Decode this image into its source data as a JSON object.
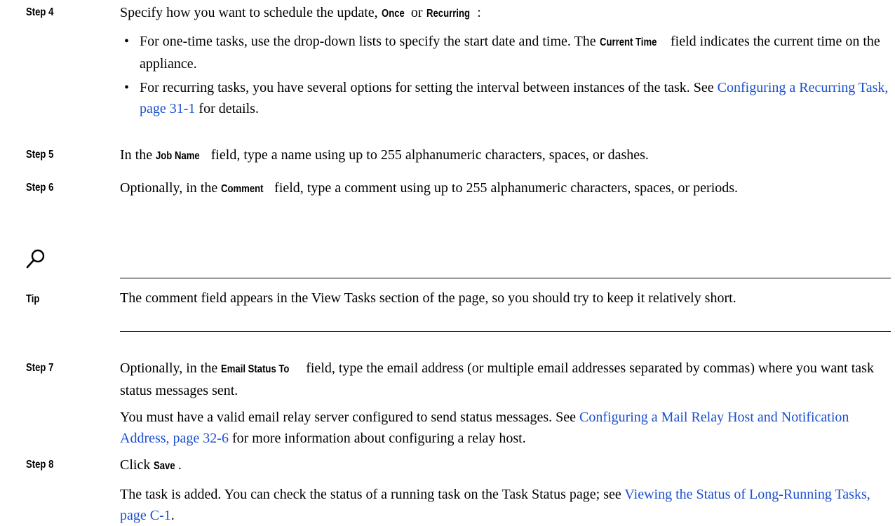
{
  "steps": {
    "s4": {
      "label": "Step 4",
      "pre": "Specify how you want to schedule the update, ",
      "once": "Once",
      "or": " or ",
      "recurring": "Recurring",
      "post": ":",
      "bullet1_pre": "For one-time tasks, use the drop-down lists to specify the start date and time. The ",
      "bullet1_bold": "Current Time",
      "bullet1_post": " field indicates the current time on the appliance.",
      "bullet2_pre": "For recurring tasks, you have several options for setting the interval between instances of the task. See ",
      "bullet2_link": "Configuring a Recurring Task, page 31-1",
      "bullet2_post": " for details."
    },
    "s5": {
      "label": "Step 5",
      "pre": "In the ",
      "bold": "Job Name",
      "post": " field, type a name using up to 255 alphanumeric characters, spaces, or dashes."
    },
    "s6": {
      "label": "Step 6",
      "pre": "Optionally, in the ",
      "bold": "Comment",
      "post": " field, type a comment using up to 255 alphanumeric characters, spaces, or periods."
    },
    "tip": {
      "label": "Tip",
      "icon": "magnifier-icon",
      "text": "The comment field appears in the View Tasks section of the page, so you should try to keep it relatively short."
    },
    "s7": {
      "label": "Step 7",
      "pre": "Optionally, in the ",
      "bold": "Email Status To",
      "post": " field, type the email address (or multiple email addresses separated by commas) where you want task status messages sent.",
      "para2_pre": "You must have a valid email relay server configured to send status messages. See ",
      "para2_link": "Configuring a Mail Relay Host and Notification Address, page 32-6",
      "para2_post": " for more information about configuring a relay host."
    },
    "s8": {
      "label": "Step 8",
      "pre": "Click ",
      "bold": "Save",
      "post": ".",
      "para2_pre": "The task is added. You can check the status of a running task on the Task Status page; see ",
      "para2_link": "Viewing the Status of Long-Running Tasks, page C-1",
      "para2_post": "."
    }
  },
  "colors": {
    "link": "#1a4fd0",
    "text": "#000000"
  }
}
